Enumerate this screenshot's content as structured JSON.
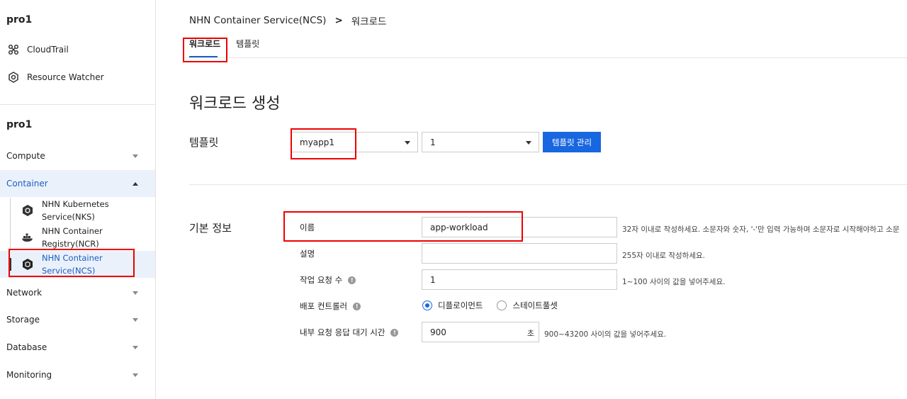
{
  "sidebar": {
    "project_top": "pro1",
    "links": [
      {
        "label": "CloudTrail",
        "icon": "cloudtrail-icon"
      },
      {
        "label": "Resource Watcher",
        "icon": "resource-watcher-icon"
      }
    ],
    "project": "pro1",
    "categories": {
      "compute": "Compute",
      "container": "Container",
      "network": "Network",
      "storage": "Storage",
      "database": "Database",
      "monitoring": "Monitoring"
    },
    "container_items": [
      {
        "label1": "NHN Kubernetes",
        "label2": "Service(NKS)",
        "icon": "kubernetes-icon"
      },
      {
        "label1": "NHN Container",
        "label2": "Registry(NCR)",
        "icon": "docker-icon"
      },
      {
        "label1": "NHN Container",
        "label2": "Service(NCS)",
        "icon": "container-service-icon"
      }
    ]
  },
  "breadcrumb": {
    "service": "NHN Container Service(NCS)",
    "separator": ">",
    "current": "워크로드"
  },
  "tabs": [
    "워크로드",
    "템플릿"
  ],
  "page_title": "워크로드 생성",
  "template_section": {
    "label": "템플릿",
    "template_value": "myapp1",
    "version_value": "1",
    "manage_button": "템플릿 관리"
  },
  "basic_info": {
    "label": "기본 정보",
    "name_label": "이름",
    "name_value": "app-workload",
    "name_hint": "32자 이내로 작성하세요. 소문자와 숫자, '-'만 입력 가능하며 소문자로 시작해야하고 소문",
    "desc_label": "설명",
    "desc_value": "",
    "desc_hint": "255자 이내로 작성하세요.",
    "count_label": "작업 요청 수",
    "count_value": "1",
    "count_hint": "1~100 사이의 값을 넣어주세요.",
    "controller_label": "배포 컨트롤러",
    "controller_options": [
      "디플로이먼트",
      "스테이트풀셋"
    ],
    "controller_selected": "디플로이먼트",
    "timeout_label": "내부 요청 응답 대기 시간",
    "timeout_value": "900",
    "timeout_unit": "초",
    "timeout_hint": "900~43200 사이의 값을 넣어주세요."
  },
  "colors": {
    "accent": "#1866e0",
    "active_bg": "#eaf1fb",
    "active_text": "#1b5fc1",
    "highlight": "#e00000"
  }
}
